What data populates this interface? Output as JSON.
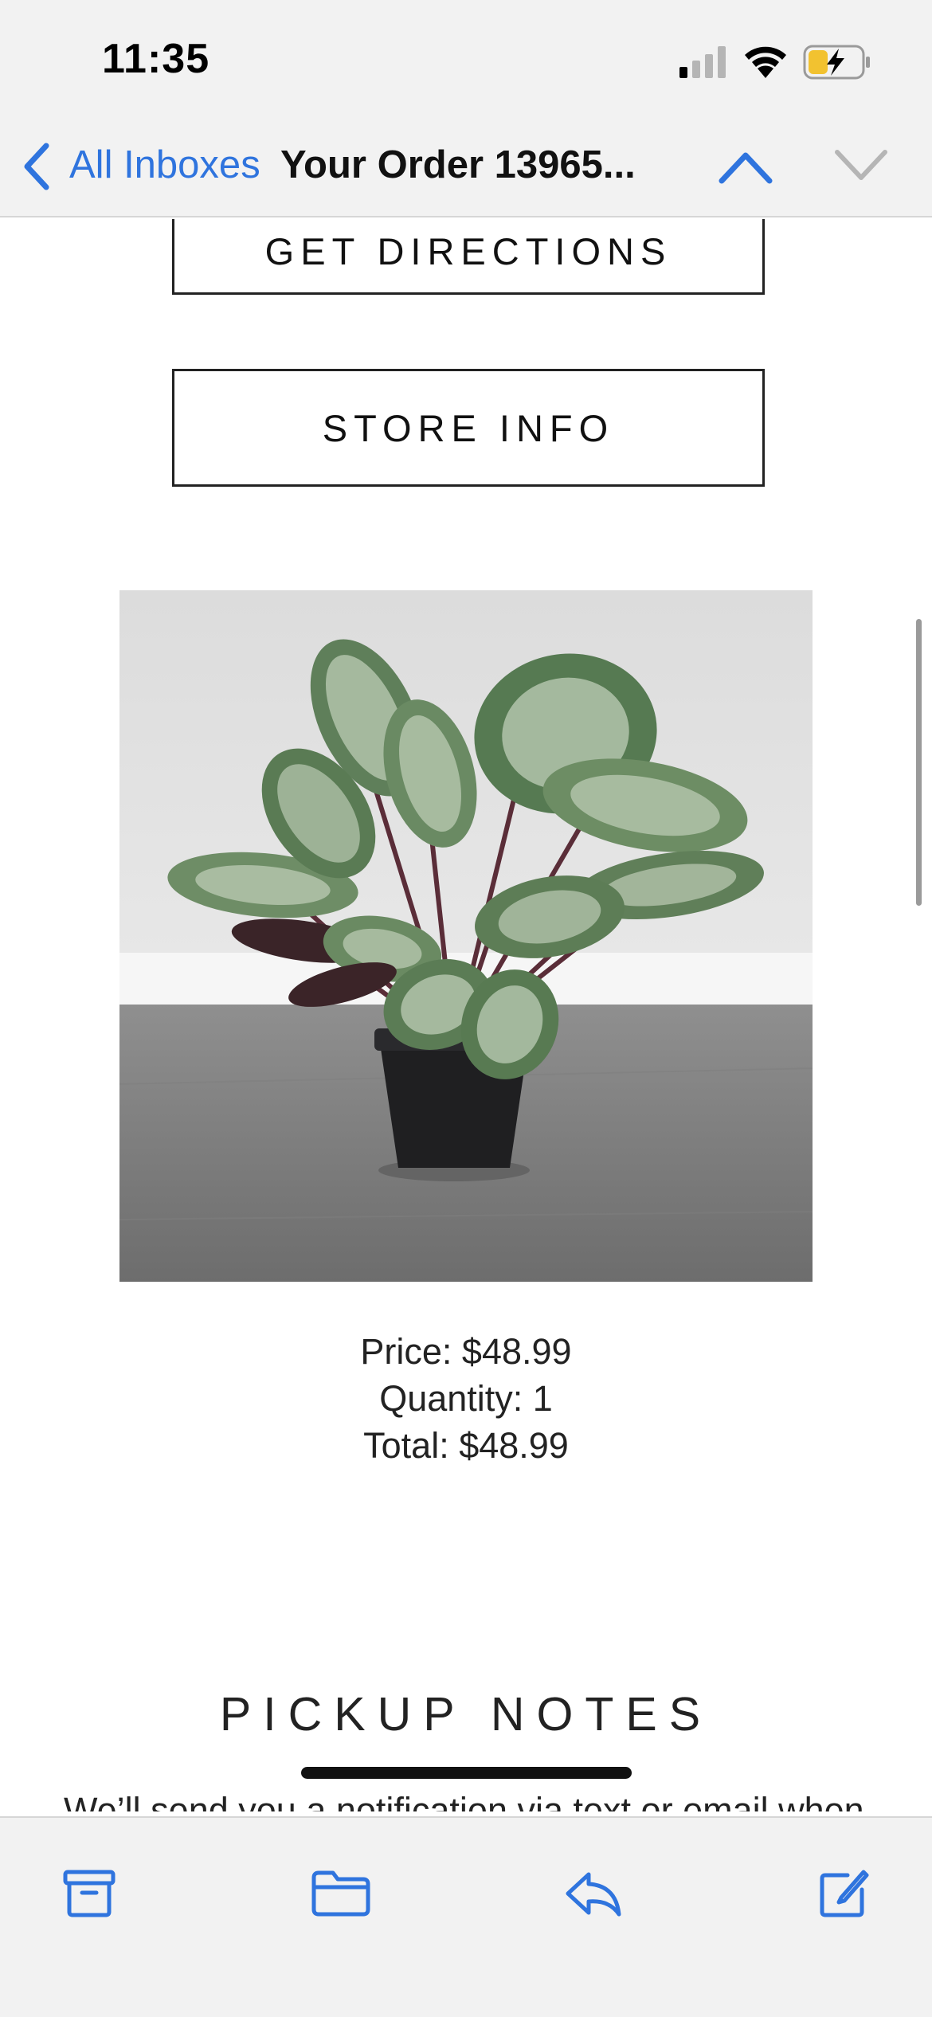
{
  "status_bar": {
    "time": "11:35",
    "icons": [
      "signal-icon",
      "wifi-icon",
      "battery-charging-icon"
    ]
  },
  "nav": {
    "back_label": "All Inboxes",
    "title": "Your Order 13965...",
    "icons": [
      "chevron-left-icon",
      "chevron-up-icon",
      "chevron-down-icon"
    ]
  },
  "email": {
    "directions_button": "GET DIRECTIONS",
    "store_info_button": "STORE INFO",
    "product": {
      "price": "Price: $48.99",
      "quantity": "Quantity: 1",
      "total": "Total: $48.99"
    },
    "pickup_heading": "PICKUP NOTES",
    "pickup_text": "We’ll send you a notification via text or email when"
  },
  "toolbar": {
    "icons": [
      "archive-icon",
      "folder-icon",
      "reply-icon",
      "compose-icon"
    ]
  },
  "colors": {
    "accent": "#2f74de",
    "bar_background": "#f2f2f2",
    "text": "#222222"
  }
}
